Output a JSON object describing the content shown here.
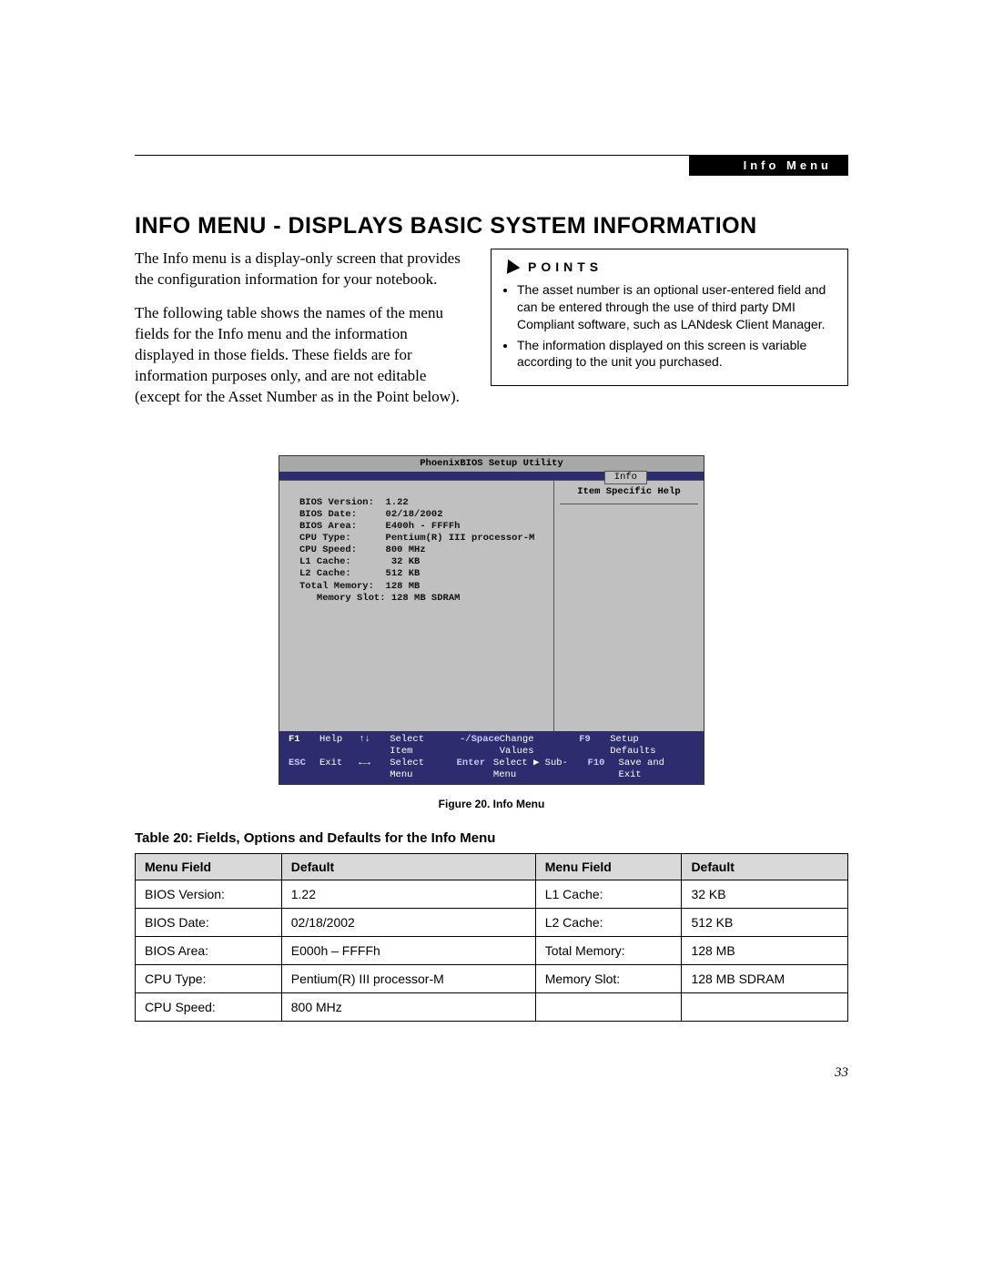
{
  "header": {
    "section_label": "Info Menu"
  },
  "title": "INFO MENU - DISPLAYS BASIC SYSTEM INFORMATION",
  "body": {
    "para1": "The Info menu is a display-only screen that provides the configuration information for your notebook.",
    "para2": "The following table shows the names of the menu fields for the Info menu and the information displayed in those fields. These fields are for information purposes only, and are not editable (except for the Asset Number as in the Point below)."
  },
  "points": {
    "heading": "POINTS",
    "items": [
      "The asset number is an optional user-entered field and can be entered through the use of third party DMI Compliant software, such as LANdesk Client Manager.",
      "The information displayed on this screen is variable according to the unit you purchased."
    ]
  },
  "bios": {
    "title": "PhoenixBIOS Setup Utility",
    "tab": "Info",
    "help_title": "Item Specific Help",
    "rows": [
      "BIOS Version:  1.22",
      "BIOS Date:     02/18/2002",
      "BIOS Area:     E400h - FFFFh",
      "",
      "CPU Type:      Pentium(R) III processor-M",
      "CPU Speed:     800 MHz",
      "L1 Cache:       32 KB",
      "L2 Cache:      512 KB",
      "",
      "Total Memory:  128 MB",
      "   Memory Slot: 128 MB SDRAM"
    ],
    "footer": {
      "f1": "F1",
      "help": "Help",
      "updown": "↑↓",
      "select_item": "Select Item",
      "minus": "-/Space",
      "change_values": "Change Values",
      "f9": "F9",
      "setup_defaults": "Setup Defaults",
      "esc": "ESC",
      "exit": "Exit",
      "leftright": "←→",
      "select_menu": "Select Menu",
      "enter": "Enter",
      "select_submenu": "Select ▶ Sub-Menu",
      "f10": "F10",
      "save_exit": "Save and Exit"
    }
  },
  "figure_caption": "Figure 20.  Info Menu",
  "table_title": "Table 20: Fields, Options and Defaults for the Info Menu",
  "table": {
    "headers": [
      "Menu Field",
      "Default",
      "Menu Field",
      "Default"
    ],
    "rows": [
      [
        "BIOS Version:",
        "1.22",
        "L1 Cache:",
        "32 KB"
      ],
      [
        "BIOS Date:",
        "02/18/2002",
        "L2 Cache:",
        "512 KB"
      ],
      [
        "BIOS Area:",
        "E000h – FFFFh",
        "Total Memory:",
        "128 MB"
      ],
      [
        "CPU Type:",
        "Pentium(R) III processor-M",
        "Memory Slot:",
        "128 MB SDRAM"
      ],
      [
        "CPU Speed:",
        "800 MHz",
        "",
        ""
      ]
    ]
  },
  "page_number": "33"
}
